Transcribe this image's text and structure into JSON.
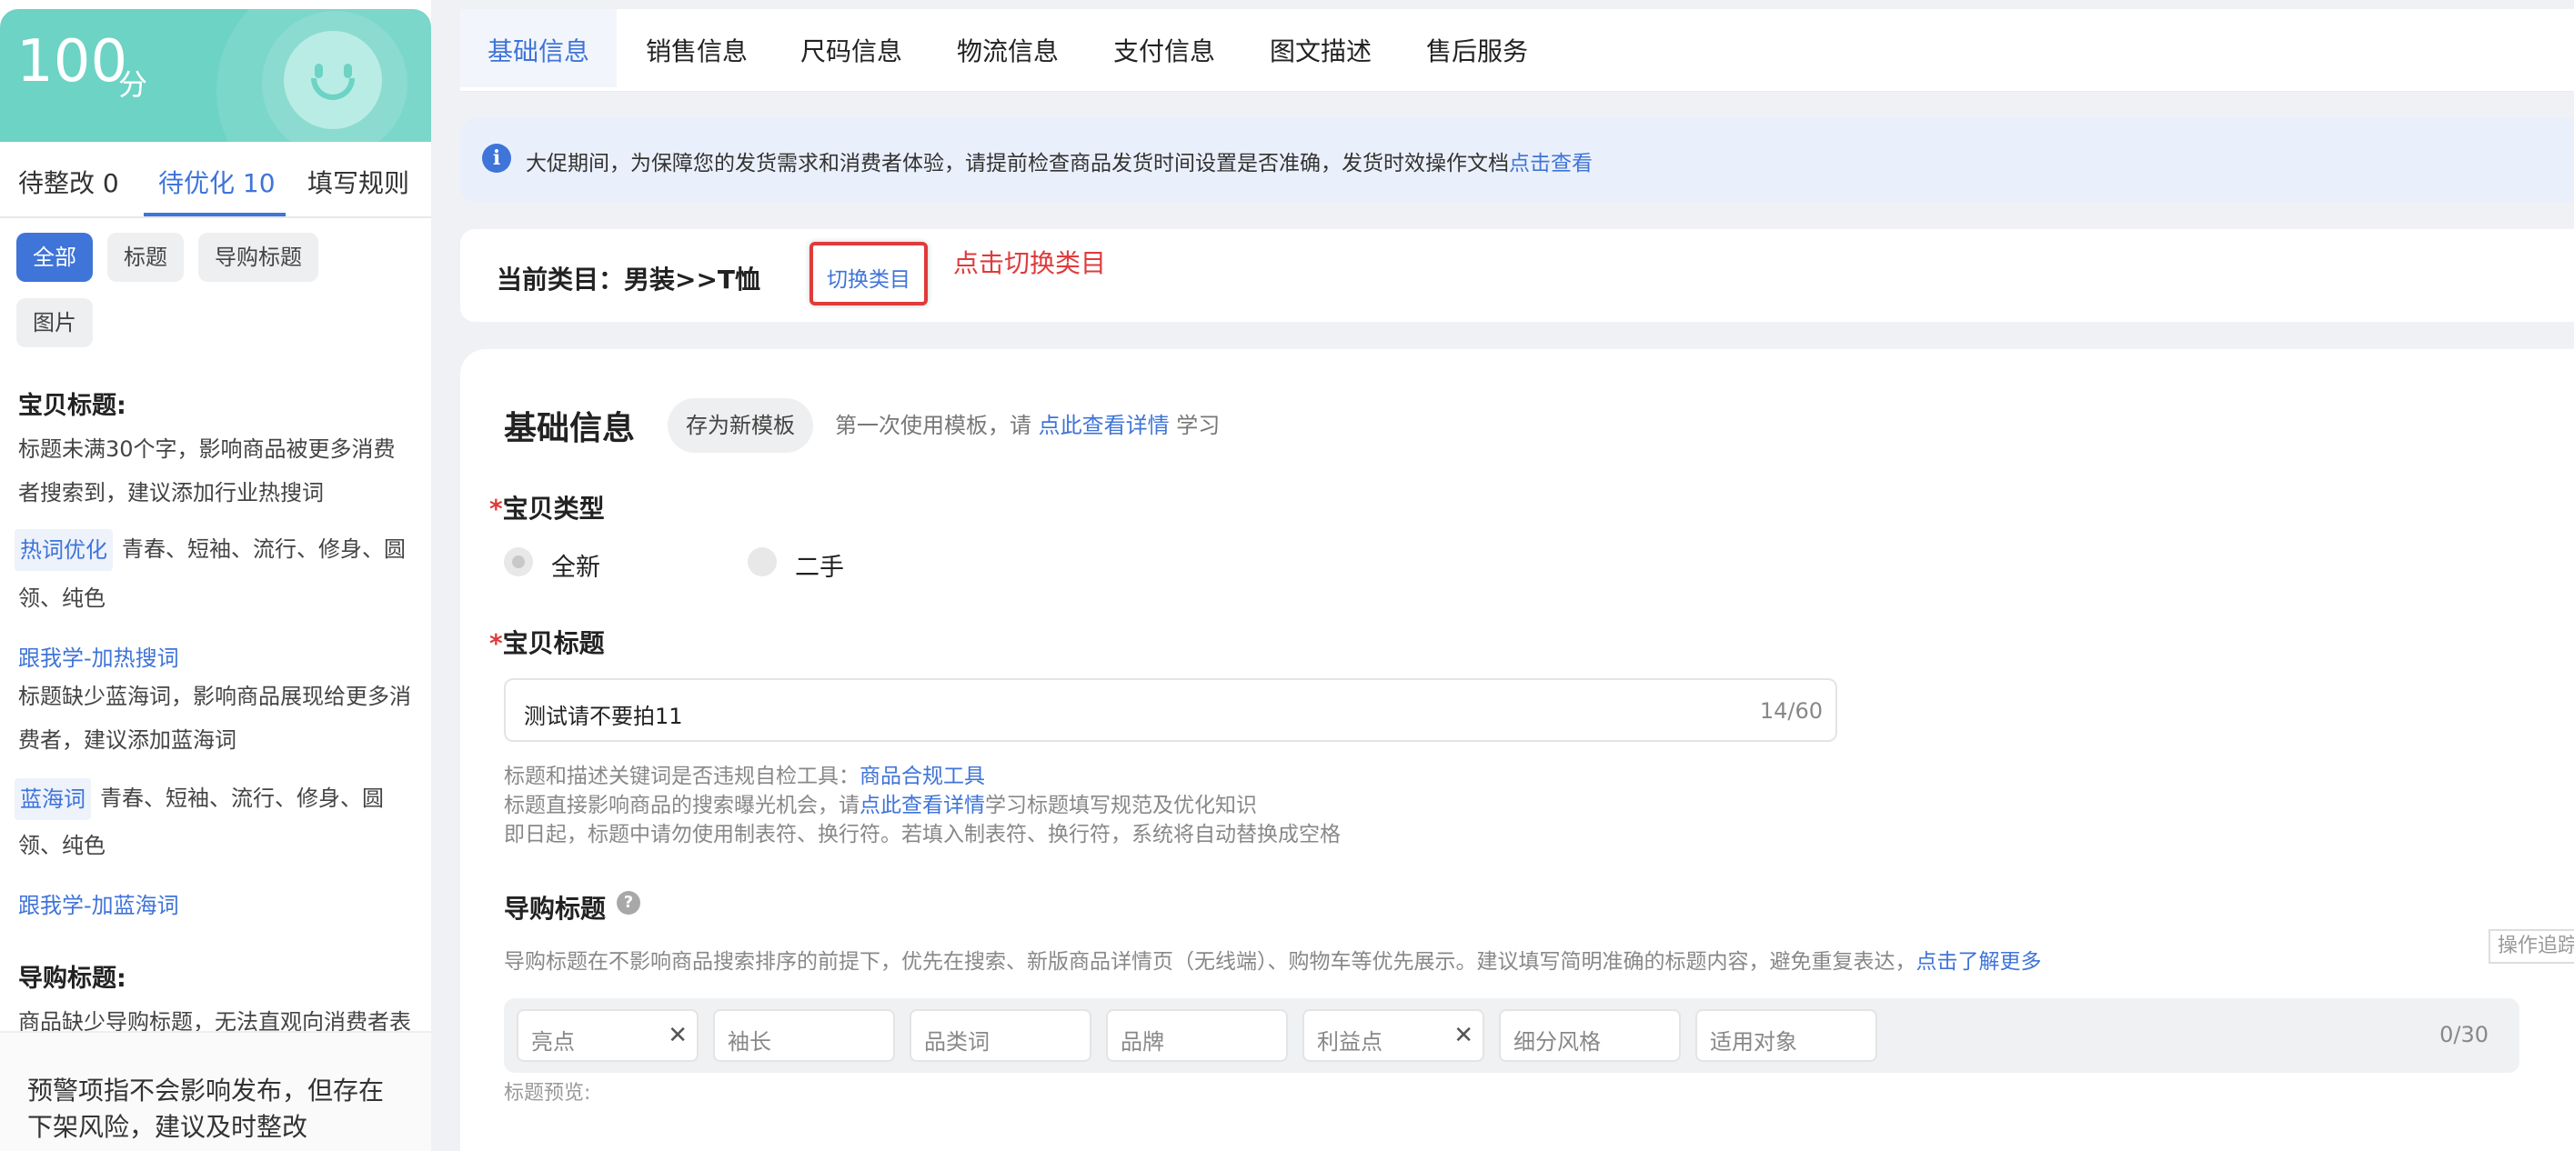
{
  "left_panel": {
    "score": {
      "value": "100",
      "unit": "分"
    },
    "tabs": [
      {
        "label": "待整改 0"
      },
      {
        "label": "待优化 10"
      },
      {
        "label": "填写规则"
      }
    ],
    "filters": [
      "全部",
      "标题",
      "导购标题",
      "图片"
    ],
    "title_section": {
      "heading": "宝贝标题:",
      "issue1_lines": [
        "标题未满30个字，影响商品被更多消费",
        "者搜索到，建议添加行业热搜词"
      ],
      "hot_tag": "热词优化",
      "hot_words_line1": "青春、短袖、流行、修身、圆",
      "hot_words_line2": "领、纯色",
      "learn_hot_link": "跟我学-加热搜词",
      "issue2_lines": [
        "标题缺少蓝海词，影响商品展现给更多消",
        "费者，建议添加蓝海词"
      ],
      "blue_tag": "蓝海词",
      "blue_words_line1": "青春、短袖、流行、修身、圆",
      "blue_words_line2": "领、纯色",
      "learn_blue_link": "跟我学-加蓝海词"
    },
    "guide_section": {
      "heading": "导购标题:",
      "issue_line": "商品缺少导购标题，无法直观向消费者表"
    },
    "footer_lines": [
      "预警项指不会影响发布，但存在",
      "下架风险，建议及时整改"
    ]
  },
  "top_tabs": [
    "基础信息",
    "销售信息",
    "尺码信息",
    "物流信息",
    "支付信息",
    "图文描述",
    "售后服务"
  ],
  "notice": {
    "text": "大促期间，为保障您的发货需求和消费者体验，请提前检查商品发货时间设置是否准确，发货时效操作文档",
    "link": "点击查看"
  },
  "category": {
    "label": "当前类目：男装>>T恤",
    "switch_button": "切换类目",
    "annotation": "点击切换类目"
  },
  "form": {
    "title": "基础信息",
    "save_template": "存为新模板",
    "template_hint_prefix": "第一次使用模板，请",
    "template_hint_link": "点此查看详情",
    "template_hint_suffix": "学习",
    "item_type": {
      "label": "宝贝类型",
      "required_mark": "*",
      "options": [
        "全新",
        "二手"
      ],
      "selected": "全新"
    },
    "item_title": {
      "label": "宝贝标题",
      "required_mark": "*",
      "value": "测试请不要拍11",
      "counter": "14/60",
      "help1_prefix": "标题和描述关键词是否违规自检工具：",
      "help1_link": "商品合规工具",
      "help2_prefix": "标题直接影响商品的搜索曝光机会，请",
      "help2_link": "点此查看详情",
      "help2_suffix": "学习标题填写规范及优化知识",
      "help3": "即日起，标题中请勿使用制表符、换行符。若填入制表符、换行符，系统将自动替换成空格"
    },
    "guide_title": {
      "label": "导购标题",
      "help_icon": "question-icon",
      "description": "导购标题在不影响商品搜索排序的前提下，优先在搜索、新版商品详情页（无线端）、购物车等优先展示。建议填写简明准确的标题内容，避免重复表达，",
      "description_link": "点击了解更多",
      "keywords": [
        {
          "placeholder": "亮点",
          "clearable": true
        },
        {
          "placeholder": "袖长",
          "clearable": false
        },
        {
          "placeholder": "品类词",
          "clearable": false
        },
        {
          "placeholder": "品牌",
          "clearable": false
        },
        {
          "placeholder": "利益点",
          "clearable": true
        },
        {
          "placeholder": "细分风格",
          "clearable": false
        },
        {
          "placeholder": "适用对象",
          "clearable": false
        }
      ],
      "counter": "0/30",
      "preview_label": "标题预览:"
    }
  },
  "side_button": "操作追踪",
  "colors": {
    "accent": "#3f74d8",
    "score_header": "#6cd3c5",
    "annotation_red": "#e03a3a",
    "notice_bg": "#eaf0fb"
  }
}
